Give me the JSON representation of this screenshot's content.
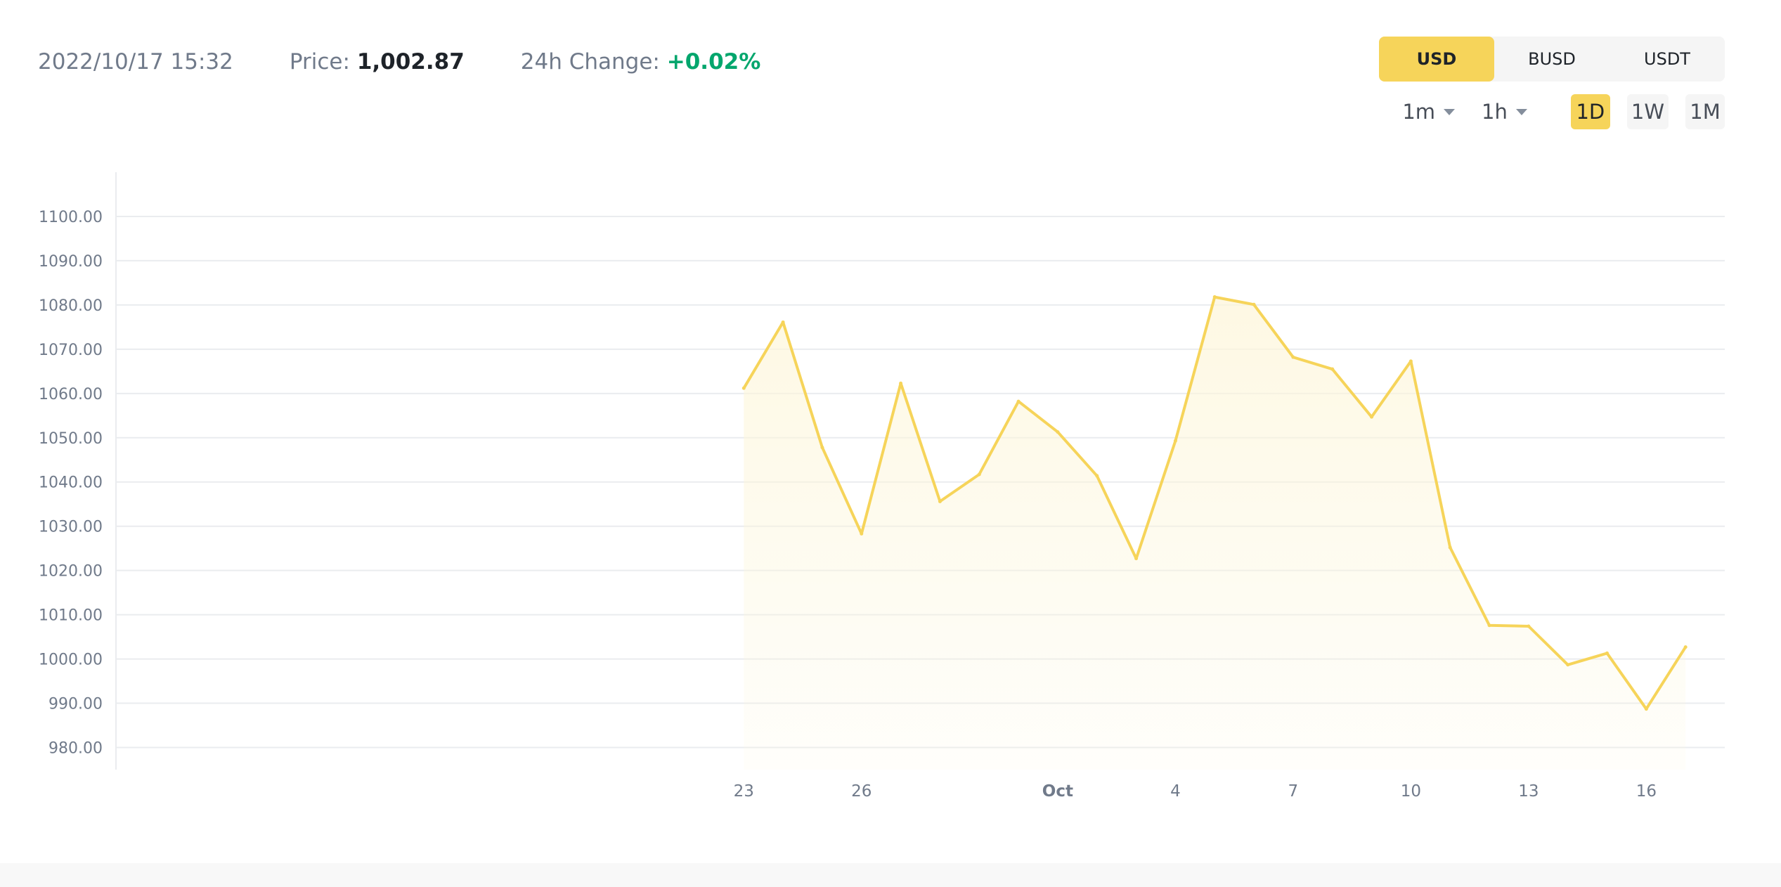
{
  "header": {
    "timestamp": "2022/10/17 15:32",
    "price_label": "Price:",
    "price_value": "1,002.87",
    "change_label": "24h Change:",
    "change_value": "+0.02%"
  },
  "currency_toggle": {
    "options": [
      "USD",
      "BUSD",
      "USDT"
    ],
    "selected": "USD"
  },
  "interval_selects": [
    "1m",
    "1h"
  ],
  "range_buttons": [
    "1D",
    "1W",
    "1M"
  ],
  "range_selected": "1D",
  "colors": {
    "line": "#f6d45a",
    "fill": "#fdf6da",
    "grid": "#eaecef",
    "axis_text": "#707a8a",
    "positive": "#03a66d",
    "accent": "#f6d45a"
  },
  "chart_data": {
    "type": "area",
    "title": "",
    "xlabel": "",
    "ylabel": "",
    "ylim": [
      975,
      1110
    ],
    "yticks": [
      980,
      990,
      1000,
      1010,
      1020,
      1030,
      1040,
      1050,
      1060,
      1070,
      1080,
      1090,
      1100
    ],
    "ytick_labels": [
      "980.00",
      "990.00",
      "1000.00",
      "1010.00",
      "1020.00",
      "1030.00",
      "1040.00",
      "1050.00",
      "1060.00",
      "1070.00",
      "1080.00",
      "1090.00",
      "1100.00"
    ],
    "x_range": [
      "2022-09-07",
      "2022-10-18"
    ],
    "xticks": [
      {
        "date": "2022-09-23",
        "label": "23",
        "bold": false
      },
      {
        "date": "2022-09-26",
        "label": "26",
        "bold": false
      },
      {
        "date": "2022-10-01",
        "label": "Oct",
        "bold": true
      },
      {
        "date": "2022-10-04",
        "label": "4",
        "bold": false
      },
      {
        "date": "2022-10-07",
        "label": "7",
        "bold": false
      },
      {
        "date": "2022-10-10",
        "label": "10",
        "bold": false
      },
      {
        "date": "2022-10-13",
        "label": "13",
        "bold": false
      },
      {
        "date": "2022-10-16",
        "label": "16",
        "bold": false
      }
    ],
    "grid": true,
    "series": [
      {
        "x": [
          "2022-09-23",
          "2022-09-24",
          "2022-09-25",
          "2022-09-26",
          "2022-09-27",
          "2022-09-28",
          "2022-09-29",
          "2022-09-30",
          "2022-10-01",
          "2022-10-02",
          "2022-10-03",
          "2022-10-04",
          "2022-10-05",
          "2022-10-06",
          "2022-10-07",
          "2022-10-08",
          "2022-10-09",
          "2022-10-10",
          "2022-10-11",
          "2022-10-12",
          "2022-10-13",
          "2022-10-14",
          "2022-10-15",
          "2022-10-16",
          "2022-10-17"
        ],
        "values": [
          1061.2,
          1076.1,
          1047.8,
          1028.3,
          1062.3,
          1035.6,
          1041.7,
          1058.2,
          1051.3,
          1041.4,
          1022.7,
          1049.3,
          1081.8,
          1080.1,
          1068.2,
          1065.5,
          1054.7,
          1067.3,
          1025.2,
          1007.6,
          1007.4,
          998.7,
          1001.3,
          988.7,
          1002.7
        ]
      }
    ]
  }
}
